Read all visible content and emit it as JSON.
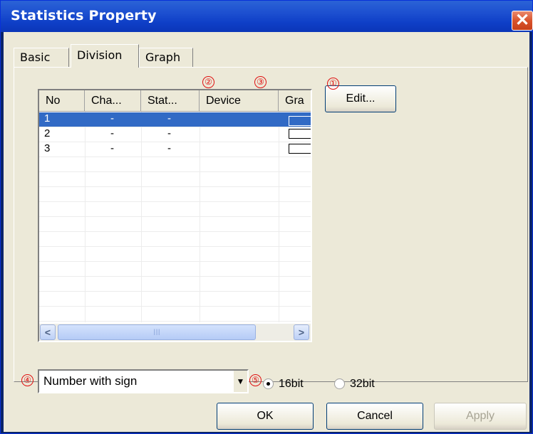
{
  "window": {
    "title": "Statistics Property",
    "close_glyph": "✕"
  },
  "tabs": [
    {
      "label": "Basic",
      "active": false
    },
    {
      "label": "Division",
      "active": true
    },
    {
      "label": "Graph",
      "active": false
    }
  ],
  "list": {
    "columns": [
      "No",
      "Cha...",
      "Stat...",
      "Device",
      "Gra"
    ],
    "rows": [
      {
        "no": "1",
        "cha": "-",
        "stat": "-",
        "device": "",
        "selected": true
      },
      {
        "no": "2",
        "cha": "-",
        "stat": "-",
        "device": "",
        "selected": false
      },
      {
        "no": "3",
        "cha": "-",
        "stat": "-",
        "device": "",
        "selected": false
      }
    ],
    "scroll_left_glyph": "<",
    "scroll_right_glyph": ">",
    "scroll_thumb_grip": "III"
  },
  "buttons": {
    "edit": "Edit...",
    "ok": "OK",
    "cancel": "Cancel",
    "apply": "Apply"
  },
  "combo": {
    "value": "Number with sign",
    "arrow": "▼"
  },
  "radios": [
    {
      "label": "16bit",
      "checked": true
    },
    {
      "label": "32bit",
      "checked": false
    }
  ],
  "markers": [
    "①",
    "②",
    "③",
    "④",
    "⑤"
  ],
  "colors": {
    "selection": "#316ac5",
    "marker": "#e01010",
    "titlebar": "#0f3fc7"
  }
}
